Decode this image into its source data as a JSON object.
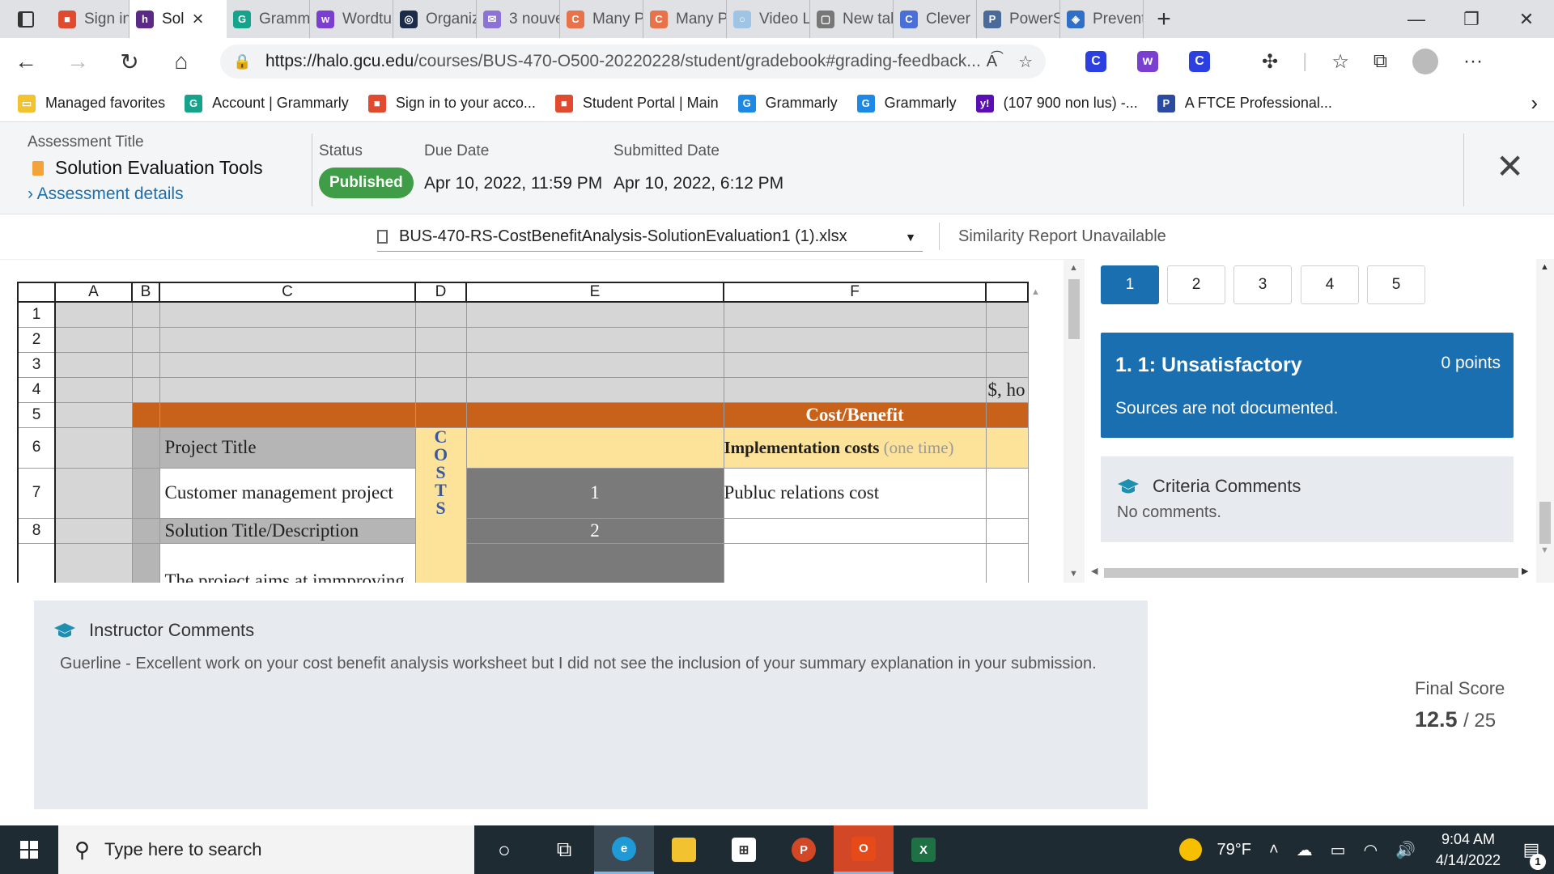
{
  "browser": {
    "tabs": [
      {
        "label": "Sign in",
        "color": "#e04a2f",
        "glyph": "■"
      },
      {
        "label": "Sol",
        "color": "#5b2a86",
        "glyph": "h",
        "active": true
      },
      {
        "label": "Gramm",
        "color": "#15a38c",
        "glyph": "G"
      },
      {
        "label": "Wordtu",
        "color": "#7b3fd0",
        "glyph": "w"
      },
      {
        "label": "Organiz",
        "color": "#1c2b4a",
        "glyph": "◎"
      },
      {
        "label": "3 nouve",
        "color": "#8c72d6",
        "glyph": "✉"
      },
      {
        "label": "Many P",
        "color": "#e8734b",
        "glyph": "C"
      },
      {
        "label": "Many P",
        "color": "#e8734b",
        "glyph": "C"
      },
      {
        "label": "Video L",
        "color": "#9fc4e6",
        "glyph": "○"
      },
      {
        "label": "New tal",
        "color": "#777777",
        "glyph": "▢"
      },
      {
        "label": "Clever",
        "color": "#4a6fd8",
        "glyph": "C"
      },
      {
        "label": "PowerS",
        "color": "#4a6a9a",
        "glyph": "P"
      },
      {
        "label": "Prevent",
        "color": "#2f6fc6",
        "glyph": "◈"
      }
    ],
    "url_host": "https://halo.gcu.edu",
    "url_path": "/courses/BUS-470-O500-20220228/student/gradebook#grading-feedback...",
    "read_aloud": "A͡",
    "extensions": [
      {
        "glyph": "C",
        "color": "#2c3fe0"
      },
      {
        "glyph": "w",
        "color": "#7b3fd0"
      },
      {
        "glyph": "C",
        "color": "#2c3fe0"
      }
    ],
    "bookmarks": [
      {
        "label": "Managed favorites",
        "color": "#f2c230",
        "glyph": "▭"
      },
      {
        "label": "Account | Grammarly",
        "color": "#15a38c",
        "glyph": "G"
      },
      {
        "label": "Sign in to your acco...",
        "color": "#e04a2f",
        "glyph": "■"
      },
      {
        "label": "Student Portal | Main",
        "color": "#e04a2f",
        "glyph": "■"
      },
      {
        "label": "Grammarly",
        "color": "#1e88e5",
        "glyph": "G"
      },
      {
        "label": "Grammarly",
        "color": "#1e88e5",
        "glyph": "G"
      },
      {
        "label": "(107 900 non lus) -...",
        "color": "#5a0fb4",
        "glyph": "y!"
      },
      {
        "label": "A FTCE Professional...",
        "color": "#2c4aa0",
        "glyph": "P"
      }
    ]
  },
  "assessment": {
    "title_label": "Assessment Title",
    "title": "Solution Evaluation Tools",
    "details_link": "Assessment details",
    "status_label": "Status",
    "status": "Published",
    "due_label": "Due Date",
    "due": "Apr 10, 2022, 11:59 PM",
    "submitted_label": "Submitted Date",
    "submitted": "Apr 10, 2022, 6:12 PM",
    "file_name": "BUS-470-RS-CostBenefitAnalysis-SolutionEvaluation1 (1).xlsx",
    "similarity": "Similarity Report Unavailable"
  },
  "sheet": {
    "columns": [
      "A",
      "B",
      "C",
      "D",
      "E",
      "F",
      ""
    ],
    "rows": [
      "1",
      "2",
      "3",
      "4",
      "5",
      "6",
      "7",
      "8",
      ""
    ],
    "r4_g": "$, ho",
    "r5_f": "Cost/Benefit",
    "r6_c": "Project Title",
    "r6_f_bold": "Implementation costs",
    "r6_f_light": "(one time)",
    "costs_vertical": "COSTS",
    "r7_c": "Customer management project",
    "r7_e": "1",
    "r7_f": "Publuc relations cost",
    "r8_c": "Solution Title/Description",
    "r8_e": "2",
    "r9_c": "The project aims at immproving"
  },
  "rubric": {
    "levels": [
      "1",
      "2",
      "3",
      "4",
      "5"
    ],
    "selected_title": "1. 1: Unsatisfactory",
    "selected_points": "0 points",
    "selected_desc": "Sources are not documented.",
    "criteria_comments_label": "Criteria Comments",
    "criteria_comments": "No comments."
  },
  "feedback": {
    "instructor_label": "Instructor Comments",
    "instructor_comment": "Guerline - Excellent work on your cost benefit analysis worksheet but I did not see the inclusion of your summary explanation in your submission.",
    "final_score_label": "Final Score",
    "score": "12.5",
    "out_of": "/ 25"
  },
  "taskbar": {
    "search_placeholder": "Type here to search",
    "temperature": "79°F",
    "time": "9:04 AM",
    "date": "4/14/2022",
    "notifications": "1"
  }
}
